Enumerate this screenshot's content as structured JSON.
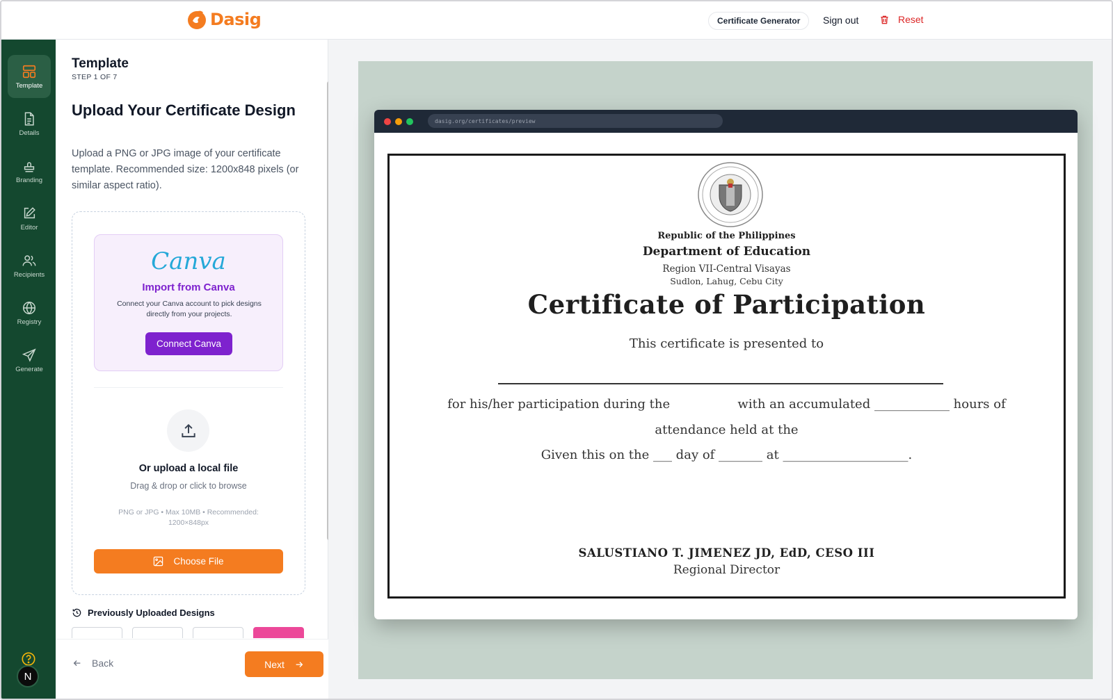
{
  "header": {
    "brand": "Dasig",
    "chip_label": "Certificate Generator",
    "signout_label": "Sign out",
    "reset_label": "Reset"
  },
  "rail": {
    "items": [
      {
        "label": "Template",
        "icon": "layout-icon"
      },
      {
        "label": "Details",
        "icon": "document-icon"
      },
      {
        "label": "Branding",
        "icon": "stamp-icon"
      },
      {
        "label": "Editor",
        "icon": "edit-icon"
      },
      {
        "label": "Recipients",
        "icon": "users-icon"
      },
      {
        "label": "Registry",
        "icon": "globe-icon"
      },
      {
        "label": "Generate",
        "icon": "send-icon"
      }
    ],
    "avatar_initial": "N"
  },
  "panel": {
    "title": "Template",
    "step": "STEP 1 OF 7",
    "heading": "Upload Your Certificate Design",
    "description": "Upload a PNG or JPG image of your certificate template. Recommended size: 1200x848 pixels (or similar aspect ratio).",
    "canva": {
      "logo": "Canva",
      "title": "Import from Canva",
      "description": "Connect your Canva account to pick designs directly from your projects.",
      "button": "Connect Canva"
    },
    "upload": {
      "title": "Or upload a local file",
      "subtitle": "Drag & drop or click to browse",
      "spec": "PNG or JPG • Max 10MB • Recommended: 1200×848px",
      "button": "Choose File"
    },
    "previous_title": "Previously Uploaded Designs",
    "back_label": "Back",
    "next_label": "Next"
  },
  "preview": {
    "url": "dasig.org/certificates/preview",
    "certificate": {
      "republic": "Republic of the Philippines",
      "department": "Department of Education",
      "region": "Region VII-Central Visayas",
      "address": "Sudlon, Lahug, Cebu City",
      "title": "Certificate of Participation",
      "presented": "This certificate is presented to",
      "body1": "for his/her participation during the                 with an accumulated ____________ hours of",
      "body2": "attendance held at the",
      "body3": "Given this on the ___ day of _______ at ____________________.",
      "signatory": "SALUSTIANO T. JIMENEZ JD, EdD, CESO III",
      "role": "Regional Director"
    }
  },
  "colors": {
    "brand_orange": "#f47c20",
    "rail_green": "#14482f",
    "canva_purple": "#7e22ce",
    "reset_red": "#dc2626"
  }
}
